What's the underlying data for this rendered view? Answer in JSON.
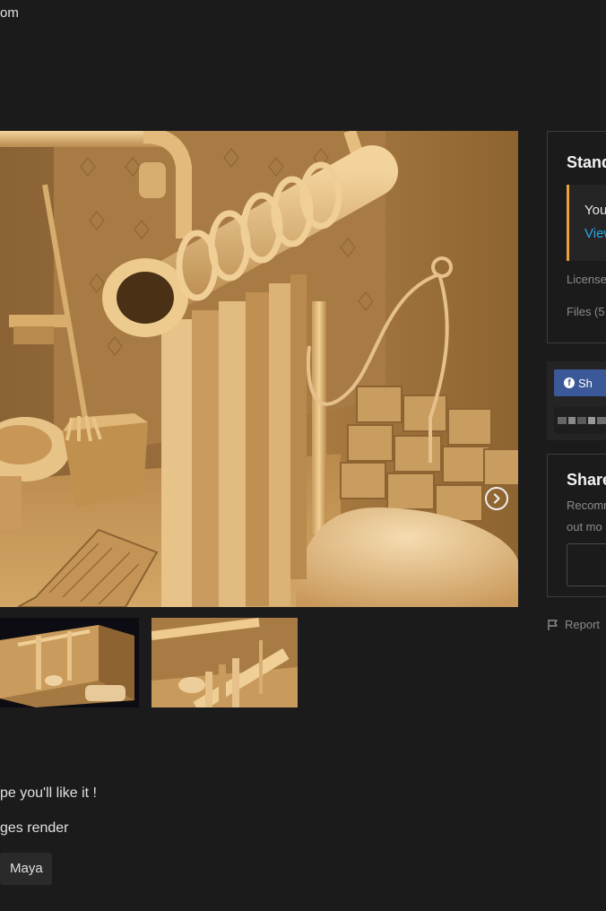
{
  "header": {
    "title_fragment": "om"
  },
  "viewer": {
    "next_label": "Next image"
  },
  "description": {
    "line1": "pe you'll like it !",
    "line2": "ges render",
    "tags": [
      "Maya"
    ]
  },
  "license_panel": {
    "title": "Stand",
    "notice_line1": "You",
    "notice_link": "View",
    "license_label": "License",
    "files_label": "Files (5"
  },
  "social_panel": {
    "facebook_label": "Sh"
  },
  "share_panel": {
    "title": "Share",
    "text_line1": "Recomm",
    "text_line2": "out mo"
  },
  "report": {
    "label": "Report"
  },
  "colors": {
    "background": "#1b1b1b",
    "accent_notice": "#e9a23b",
    "link": "#2aa7e6",
    "facebook": "#3b5998"
  }
}
